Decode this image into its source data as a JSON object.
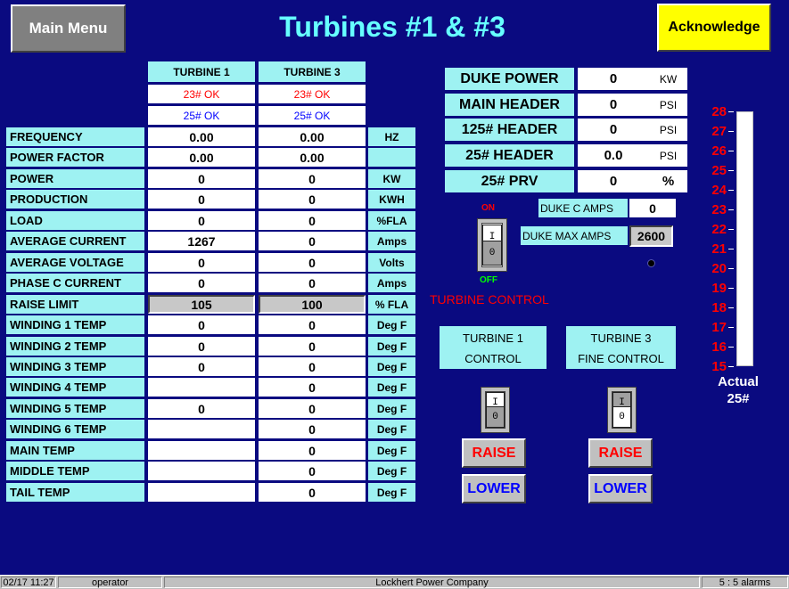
{
  "header": {
    "main_menu": "Main Menu",
    "title": "Turbines #1 & #3",
    "acknowledge": "Acknowledge"
  },
  "table": {
    "col_turbine1": "TURBINE 1",
    "col_turbine3": "TURBINE 3",
    "status_23_t1": "23# OK",
    "status_23_t3": "23# OK",
    "status_25_t1": "25# OK",
    "status_25_t3": "25# OK",
    "rows": [
      {
        "label": "FREQUENCY",
        "t1": "0.00",
        "t3": "0.00",
        "unit": "HZ"
      },
      {
        "label": "POWER FACTOR",
        "t1": "0.00",
        "t3": "0.00",
        "unit": ""
      },
      {
        "label": "POWER",
        "t1": "0",
        "t3": "0",
        "unit": "KW"
      },
      {
        "label": "PRODUCTION",
        "t1": "0",
        "t3": "0",
        "unit": "KWH"
      },
      {
        "label": "LOAD",
        "t1": "0",
        "t3": "0",
        "unit": "%FLA"
      },
      {
        "label": "AVERAGE CURRENT",
        "t1": "1267",
        "t3": "0",
        "unit": "Amps"
      },
      {
        "label": "AVERAGE VOLTAGE",
        "t1": "0",
        "t3": "0",
        "unit": "Volts"
      },
      {
        "label": "PHASE C CURRENT",
        "t1": "0",
        "t3": "0",
        "unit": "Amps"
      },
      {
        "label": "RAISE LIMIT",
        "t1": "105",
        "t3": "100",
        "unit": "% FLA"
      },
      {
        "label": "WINDING 1 TEMP",
        "t1": "0",
        "t3": "0",
        "unit": "Deg F"
      },
      {
        "label": "WINDING 2 TEMP",
        "t1": "0",
        "t3": "0",
        "unit": "Deg F"
      },
      {
        "label": "WINDING 3 TEMP",
        "t1": "0",
        "t3": "0",
        "unit": "Deg F"
      },
      {
        "label": "WINDING 4 TEMP",
        "t1": "",
        "t3": "0",
        "unit": "Deg F"
      },
      {
        "label": "WINDING 5 TEMP",
        "t1": "0",
        "t3": "0",
        "unit": "Deg F"
      },
      {
        "label": "WINDING 6 TEMP",
        "t1": "",
        "t3": "0",
        "unit": "Deg F"
      },
      {
        "label": "MAIN TEMP",
        "t1": "",
        "t3": "0",
        "unit": "Deg F"
      },
      {
        "label": "MIDDLE TEMP",
        "t1": "",
        "t3": "0",
        "unit": "Deg F"
      },
      {
        "label": "TAIL TEMP",
        "t1": "",
        "t3": "0",
        "unit": "Deg F"
      }
    ]
  },
  "power": [
    {
      "label": "DUKE POWER",
      "value": "0",
      "unit": "KW"
    },
    {
      "label": "MAIN HEADER",
      "value": "0",
      "unit": "PSI"
    },
    {
      "label": "125# HEADER",
      "value": "0",
      "unit": "PSI"
    },
    {
      "label": "25# HEADER",
      "value": "0.0",
      "unit": "PSI"
    },
    {
      "label": "25# PRV",
      "value": "0",
      "unit": "%"
    }
  ],
  "control": {
    "on_label": "ON",
    "off_label": "OFF",
    "turbine_control": "TURBINE CONTROL",
    "switch_top": "I",
    "switch_bottom": "0",
    "duke_c_amps_label": "DUKE C AMPS",
    "duke_c_amps_value": "0",
    "duke_max_amps_label": "DUKE MAX AMPS",
    "duke_max_amps_value": "2600"
  },
  "turbine1_panel": {
    "line1": "TURBINE 1",
    "line2": "CONTROL",
    "raise": "RAISE",
    "lower": "LOWER"
  },
  "turbine3_panel": {
    "line1": "TURBINE 3",
    "line2": "FINE CONTROL",
    "raise": "RAISE",
    "lower": "LOWER"
  },
  "gauge": {
    "scale": [
      "28",
      "27",
      "26",
      "25",
      "24",
      "23",
      "22",
      "21",
      "20",
      "19",
      "18",
      "17",
      "16",
      "15"
    ],
    "label1": "Actual",
    "label2": "25#",
    "min": 15,
    "max": 28,
    "value": 28
  },
  "statusbar": {
    "datetime": "02/17 11:27",
    "user": "operator",
    "company": "Lockhert Power Company",
    "alarms": "5 : 5 alarms"
  },
  "colors": {
    "background": "#0A0A80",
    "title": "#66FFFF",
    "cell_label": "#9EF2F2",
    "raise": "#FF0000",
    "lower": "#0000FF",
    "ack": "#FFFF00"
  }
}
